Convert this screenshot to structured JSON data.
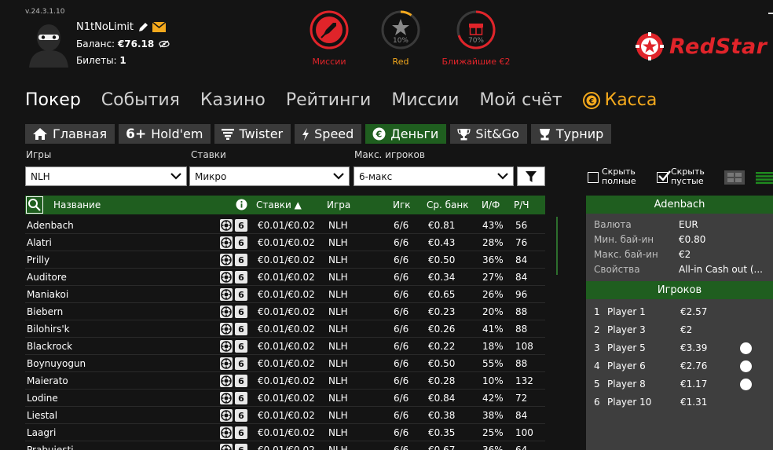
{
  "version": "v.24.3.1.10",
  "user": {
    "name": "N1tNoLimit",
    "balance_label": "Баланс:",
    "balance_value": "€76.18",
    "tickets_label": "Билеты:",
    "tickets_value": "1"
  },
  "hud": [
    {
      "label": "Миссии",
      "color": "#e0242a",
      "icon": "rocket-icon"
    },
    {
      "label": "Red",
      "color": "#f4a91d",
      "icon": "star-icon",
      "percent_text": "10%",
      "progress": 0.1
    },
    {
      "label": "Ближайшие €2",
      "color": "#e0242a",
      "icon": "gift-icon",
      "percent_text": "70%",
      "progress": 0.7
    }
  ],
  "brand": {
    "name": "RedStar",
    "color": "#e0242a"
  },
  "nav": {
    "items": [
      "Покер",
      "События",
      "Казино",
      "Рейтинги",
      "Миссии",
      "Мой счёт"
    ],
    "cashier": "Касса"
  },
  "tabs": [
    {
      "label": "Главная",
      "icon": "home-icon"
    },
    {
      "label": "Hold'em",
      "icon": "six-plus-icon",
      "prefix": "6+"
    },
    {
      "label": "Twister",
      "icon": "twister-icon"
    },
    {
      "label": "Speed",
      "icon": "lightning-icon"
    },
    {
      "label": "Деньги",
      "icon": "euro-coin-icon",
      "active": true
    },
    {
      "label": "Sit&Go",
      "icon": "trophy-icon"
    },
    {
      "label": "Турнир",
      "icon": "cup-icon"
    }
  ],
  "filters": {
    "games": {
      "label": "Игры",
      "value": "NLH"
    },
    "stakes": {
      "label": "Ставки",
      "value": "Микро"
    },
    "max_players": {
      "label": "Макс. игроков",
      "value": "6-макс"
    }
  },
  "checkboxes": {
    "hide_full_1": "Скрыть",
    "hide_full_2": "полные",
    "hide_empty_1": "Скрыть",
    "hide_empty_2": "пустые"
  },
  "table": {
    "headers": {
      "name": "Название",
      "stakes": "Ставки ▲",
      "game": "Игра",
      "players": "Игк",
      "avg_pot": "Ср. банк",
      "vpf": "И/Ф",
      "hands": "Р/Ч"
    },
    "seat_badge": "6",
    "rows": [
      {
        "name": "Adenbach",
        "stakes": "€0.01/€0.02",
        "game": "NLH",
        "players": "6/6",
        "avg_pot": "€0.81",
        "vpf": "43%",
        "hands": "56"
      },
      {
        "name": "Alatri",
        "stakes": "€0.01/€0.02",
        "game": "NLH",
        "players": "6/6",
        "avg_pot": "€0.43",
        "vpf": "28%",
        "hands": "76"
      },
      {
        "name": "Prilly",
        "stakes": "€0.01/€0.02",
        "game": "NLH",
        "players": "6/6",
        "avg_pot": "€0.50",
        "vpf": "36%",
        "hands": "84"
      },
      {
        "name": "Auditore",
        "stakes": "€0.01/€0.02",
        "game": "NLH",
        "players": "6/6",
        "avg_pot": "€0.34",
        "vpf": "27%",
        "hands": "84"
      },
      {
        "name": "Maniakoi",
        "stakes": "€0.01/€0.02",
        "game": "NLH",
        "players": "6/6",
        "avg_pot": "€0.65",
        "vpf": "26%",
        "hands": "96"
      },
      {
        "name": "Biebern",
        "stakes": "€0.01/€0.02",
        "game": "NLH",
        "players": "6/6",
        "avg_pot": "€0.23",
        "vpf": "20%",
        "hands": "88"
      },
      {
        "name": "Bilohirs'k",
        "stakes": "€0.01/€0.02",
        "game": "NLH",
        "players": "6/6",
        "avg_pot": "€0.26",
        "vpf": "41%",
        "hands": "88"
      },
      {
        "name": "Blackrock",
        "stakes": "€0.01/€0.02",
        "game": "NLH",
        "players": "6/6",
        "avg_pot": "€0.22",
        "vpf": "18%",
        "hands": "108"
      },
      {
        "name": "Boynuyogun",
        "stakes": "€0.01/€0.02",
        "game": "NLH",
        "players": "6/6",
        "avg_pot": "€0.50",
        "vpf": "55%",
        "hands": "88"
      },
      {
        "name": "Maierato",
        "stakes": "€0.01/€0.02",
        "game": "NLH",
        "players": "6/6",
        "avg_pot": "€0.28",
        "vpf": "10%",
        "hands": "132"
      },
      {
        "name": "Lodine",
        "stakes": "€0.01/€0.02",
        "game": "NLH",
        "players": "6/6",
        "avg_pot": "€0.84",
        "vpf": "42%",
        "hands": "72"
      },
      {
        "name": "Liestal",
        "stakes": "€0.01/€0.02",
        "game": "NLH",
        "players": "6/6",
        "avg_pot": "€0.38",
        "vpf": "38%",
        "hands": "84"
      },
      {
        "name": "Laagri",
        "stakes": "€0.01/€0.02",
        "game": "NLH",
        "players": "6/6",
        "avg_pot": "€0.35",
        "vpf": "25%",
        "hands": "100"
      },
      {
        "name": "Prabuiesti",
        "stakes": "€0.01/€0.02",
        "game": "NLH",
        "players": "6/6",
        "avg_pot": "€0.67",
        "vpf": "36%",
        "hands": "64"
      }
    ]
  },
  "details": {
    "title": "Adenbach",
    "rows": [
      {
        "k": "Валюта",
        "v": "EUR"
      },
      {
        "k": "Мин. бай-ин",
        "v": "€0.80"
      },
      {
        "k": "Макс. бай-ин",
        "v": "€2"
      },
      {
        "k": "Свойства",
        "v": "All-in Cash out (..."
      }
    ],
    "players_title": "Игроков",
    "players": [
      {
        "n": "1",
        "name": "Player 1",
        "stack": "€2.57",
        "badge": ""
      },
      {
        "n": "2",
        "name": "Player 3",
        "stack": "€2",
        "badge": ""
      },
      {
        "n": "3",
        "name": "Player 5",
        "stack": "€3.39",
        "badge": "D"
      },
      {
        "n": "4",
        "name": "Player 6",
        "stack": "€2.76",
        "badge": "SB"
      },
      {
        "n": "5",
        "name": "Player 8",
        "stack": "€1.17",
        "badge": "BB"
      },
      {
        "n": "6",
        "name": "Player 10",
        "stack": "€1.31",
        "badge": ""
      }
    ]
  }
}
